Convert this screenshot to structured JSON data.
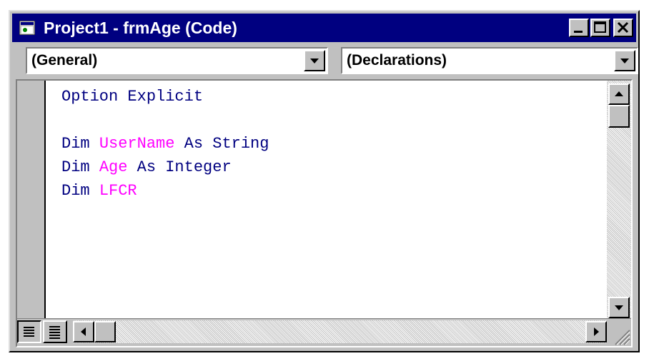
{
  "window": {
    "title": "Project1 - frmAge (Code)",
    "icons": {
      "app": "vb-form-icon",
      "minimize": "minimize-icon",
      "maximize": "maximize-icon",
      "close": "close-icon"
    }
  },
  "object_combo": {
    "value": "(General)"
  },
  "procedure_combo": {
    "value": "(Declarations)"
  },
  "code": {
    "lines": [
      [
        {
          "t": "Option Explicit",
          "k": "kw"
        }
      ],
      [],
      [
        {
          "t": "Dim ",
          "k": "kw"
        },
        {
          "t": "UserName",
          "k": "id"
        },
        {
          "t": " As String",
          "k": "kw"
        }
      ],
      [
        {
          "t": "Dim ",
          "k": "kw"
        },
        {
          "t": "Age",
          "k": "id"
        },
        {
          "t": " As Integer",
          "k": "kw"
        }
      ],
      [
        {
          "t": "Dim ",
          "k": "kw"
        },
        {
          "t": "LFCR",
          "k": "id"
        }
      ]
    ]
  },
  "colors": {
    "titlebar": "#000080",
    "keyword": "#000080",
    "identifier": "#ff00ff",
    "face": "#c0c0c0"
  }
}
